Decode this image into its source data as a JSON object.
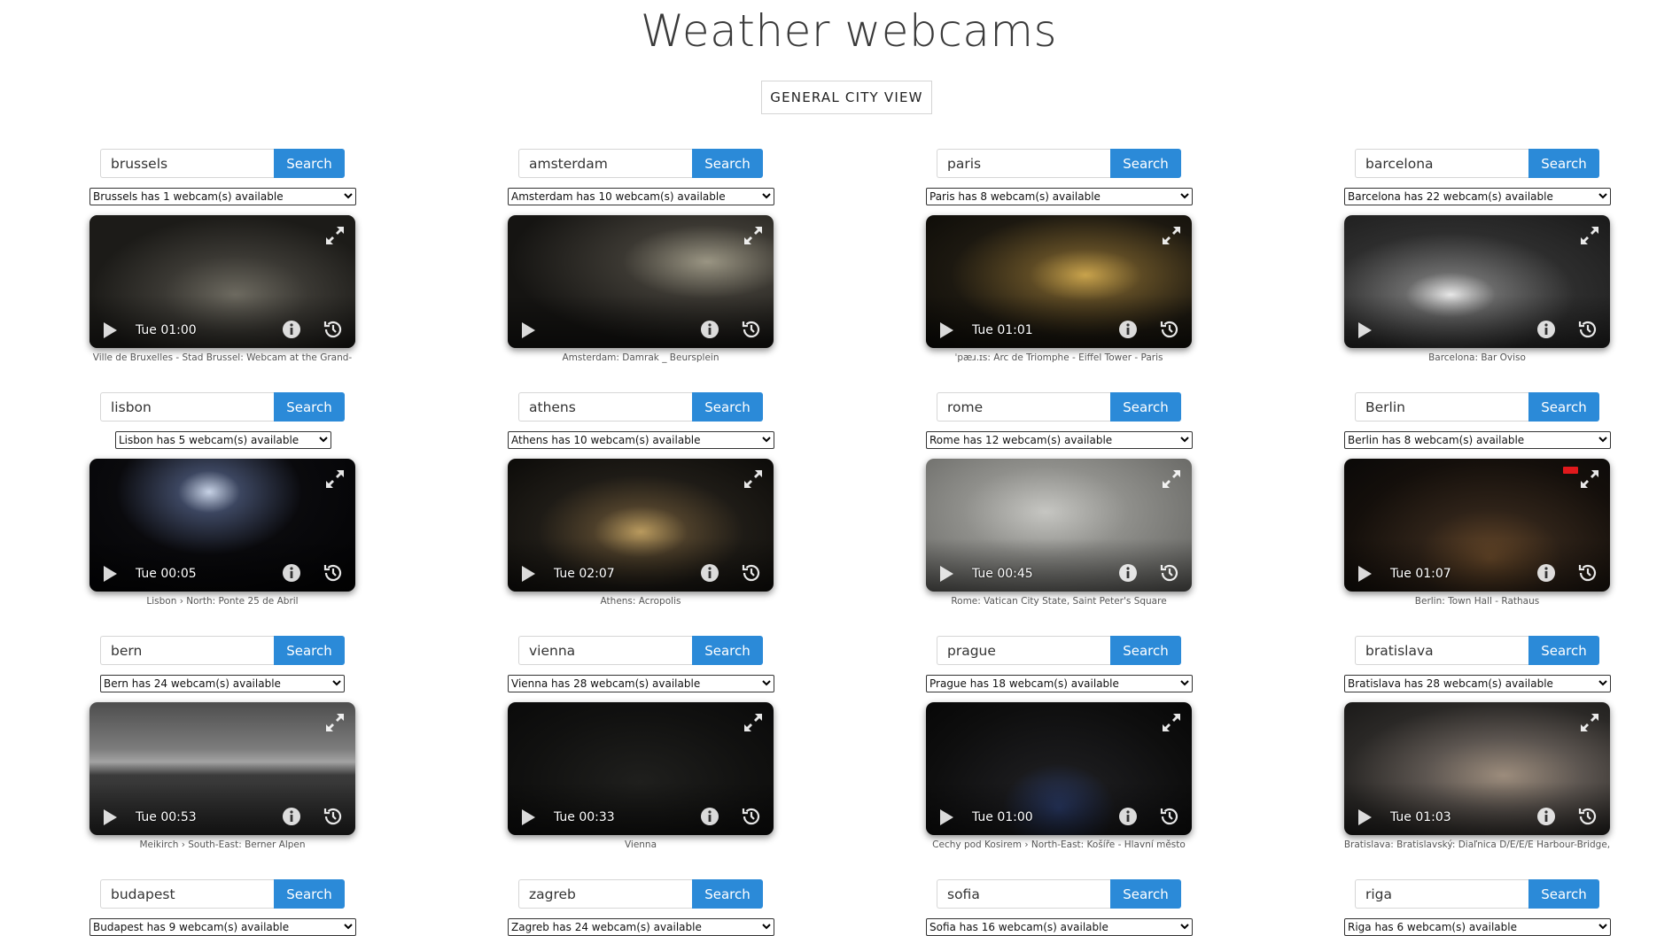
{
  "page": {
    "title": "Weather webcams",
    "city_view_button": "GENERAL CITY VIEW",
    "search_label": "Search"
  },
  "cards": [
    {
      "query": "brussels",
      "select": "Brussels has 1 webcam(s) available",
      "time": "Tue 01:00",
      "caption": "Ville de Bruxelles - Stad Brussel: Webcam at the Grand-"
    },
    {
      "query": "amsterdam",
      "select": "Amsterdam has 10 webcam(s) available",
      "time": "",
      "caption": "Amsterdam: Damrak _ Beursplein"
    },
    {
      "query": "paris",
      "select": "Paris has 8 webcam(s) available",
      "time": "Tue 01:01",
      "caption": "ˈpæɹ.ɪs: Arc de Triomphe - Eiffel Tower - Paris"
    },
    {
      "query": "barcelona",
      "select": "Barcelona has 22 webcam(s) available",
      "time": "",
      "caption": "Barcelona: Bar Oviso"
    },
    {
      "query": "lisbon",
      "select": "Lisbon has 5 webcam(s) available",
      "time": "Tue 00:05",
      "caption": "Lisbon › North: Ponte 25 de Abril"
    },
    {
      "query": "athens",
      "select": "Athens has 10 webcam(s) available",
      "time": "Tue 02:07",
      "caption": "Athens: Acropolis"
    },
    {
      "query": "rome",
      "select": "Rome has 12 webcam(s) available",
      "time": "Tue 00:45",
      "caption": "Rome: Vatican City State, Saint Peter's Square"
    },
    {
      "query": "Berlin",
      "select": "Berlin has 8 webcam(s) available",
      "time": "Tue 01:07",
      "caption": "Berlin: Town Hall - Rathaus"
    },
    {
      "query": "bern",
      "select": "Bern has 24 webcam(s) available",
      "time": "Tue 00:53",
      "caption": "Meikirch › South-East: Berner Alpen"
    },
    {
      "query": "vienna",
      "select": "Vienna has 28 webcam(s) available",
      "time": "Tue 00:33",
      "caption": "Vienna"
    },
    {
      "query": "prague",
      "select": "Prague has 18 webcam(s) available",
      "time": "Tue 01:00",
      "caption": "Cechy pod Kosirem › North-East: Košíře - Hlavní město"
    },
    {
      "query": "bratislava",
      "select": "Bratislava has 28 webcam(s) available",
      "time": "Tue 01:03",
      "caption": "Bratislava: Bratislavský: Diaľnica D/E/E/E Harbour-Bridge,"
    },
    {
      "query": "budapest",
      "select": "Budapest has 9 webcam(s) available",
      "time": "",
      "caption": ""
    },
    {
      "query": "zagreb",
      "select": "Zagreb has 24 webcam(s) available",
      "time": "",
      "caption": ""
    },
    {
      "query": "sofia",
      "select": "Sofia has 16 webcam(s) available",
      "time": "",
      "caption": ""
    },
    {
      "query": "riga",
      "select": "Riga has 6 webcam(s) available",
      "time": "",
      "caption": ""
    }
  ]
}
